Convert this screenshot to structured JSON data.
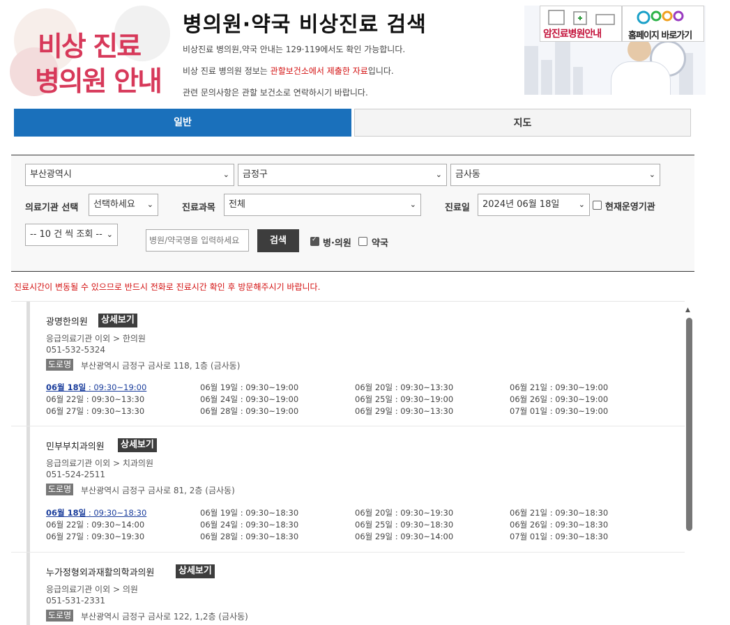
{
  "header": {
    "logo_line1": "비상 진료",
    "logo_line2": "병의원 안내",
    "title": "병의원·약국 비상진료 검색",
    "intro1": "비상진료 병의원,약국 안내는 129·119에서도 확인 가능합니다.",
    "intro2_pre": "비상 진료 병의원 정보는 ",
    "intro2_red": "관할보건소에서 제출한 자료",
    "intro2_post": "입니다.",
    "intro3": "관련 문의사항은 관할 보건소로 연락하시기 바랍니다."
  },
  "banner": {
    "cancer_label": "암진료병원안내",
    "home_label": "홈페이지 바로가기"
  },
  "tabs": [
    {
      "label": "일반"
    },
    {
      "label": "지도"
    }
  ],
  "search": {
    "city": "부산광역시",
    "district": "금정구",
    "dong": "금사동",
    "facility_label": "의료기관 선택",
    "facility_value": "선택하세요",
    "dept_label": "진료과목",
    "dept_value": "전체",
    "date_label": "진료일",
    "date_value": "2024년 06월 18일",
    "operating_label": "현재운영기관",
    "page_size": "-- 10 건 씩 조회 --",
    "name_placeholder": "병원/약국명을 입력하세요",
    "search_button": "검색",
    "clinic_label": "병·의원",
    "pharmacy_label": "약국"
  },
  "notice": "진료시간이 변동될 수 있으므로 반드시 전화로 진료시간 확인 후 방문해주시기 바랍니다.",
  "results": [
    {
      "name": "광명한의원",
      "detail_label": "상세보기",
      "category": "응급의료기관 이외 > 한의원",
      "phone": "051-532-5324",
      "road_label": "도로명",
      "address": "부산광역시 금정구 금사로 118, 1층 (금사동)",
      "schedule": [
        "06월 18일 : 09:30~19:00",
        "06월 19일 : 09:30~19:00",
        "06월 20일 : 09:30~13:30",
        "06월 21일 : 09:30~19:00",
        "06월 22일 : 09:30~13:30",
        "06월 24일 : 09:30~19:00",
        "06월 25일 : 09:30~19:00",
        "06월 26일 : 09:30~19:00",
        "06월 27일 : 09:30~13:30",
        "06월 28일 : 09:30~19:00",
        "06월 29일 : 09:30~13:30",
        "07월 01일 : 09:30~19:00"
      ]
    },
    {
      "name": "민부부치과의원",
      "detail_label": "상세보기",
      "category": "응급의료기관 이외 > 치과의원",
      "phone": "051-524-2511",
      "road_label": "도로명",
      "address": "부산광역시 금정구 금사로 81, 2층 (금사동)",
      "schedule": [
        "06월 18일 : 09:30~18:30",
        "06월 19일 : 09:30~18:30",
        "06월 20일 : 09:30~19:30",
        "06월 21일 : 09:30~18:30",
        "06월 22일 : 09:30~14:00",
        "06월 24일 : 09:30~18:30",
        "06월 25일 : 09:30~18:30",
        "06월 26일 : 09:30~18:30",
        "06월 27일 : 09:30~19:30",
        "06월 28일 : 09:30~18:30",
        "06월 29일 : 09:30~14:00",
        "07월 01일 : 09:30~18:30"
      ]
    },
    {
      "name": "누가정형외과재활의학과의원",
      "detail_label": "상세보기",
      "category": "응급의료기관 이외 > 의원",
      "phone": "051-531-2331",
      "road_label": "도로명",
      "address": "부산광역시 금정구 금사로 122, 1,2층 (금사동)",
      "schedule": []
    }
  ]
}
